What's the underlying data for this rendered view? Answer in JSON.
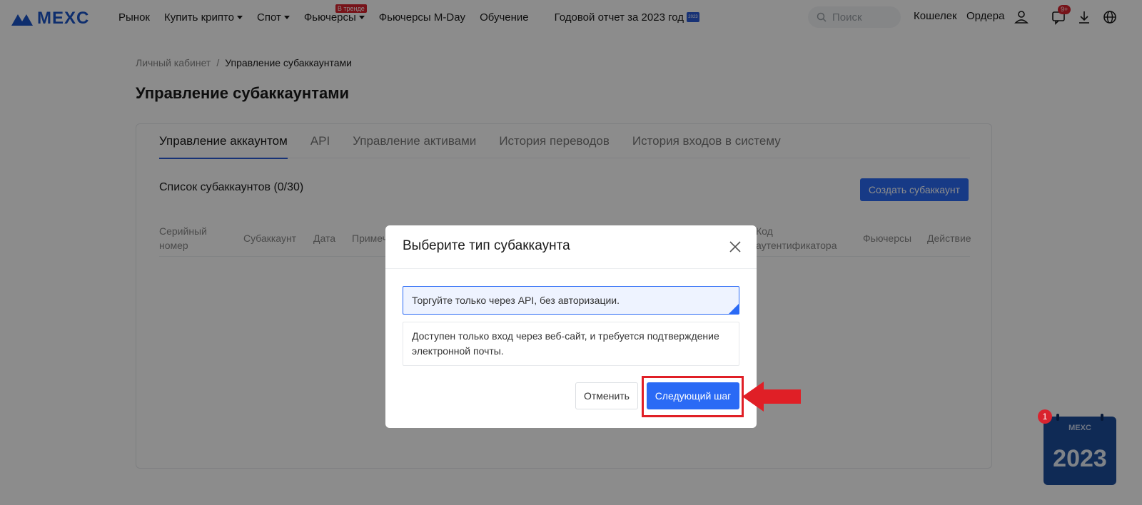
{
  "header": {
    "logo_text": "MEXC",
    "nav": [
      {
        "label": "Рынок",
        "caret": false
      },
      {
        "label": "Купить крипто",
        "caret": true
      },
      {
        "label": "Спот",
        "caret": true
      },
      {
        "label": "Фьючерсы",
        "caret": true
      },
      {
        "label": "Фьючерсы M-Day",
        "caret": false
      },
      {
        "label": "Обучение",
        "caret": false
      }
    ],
    "trend_badge": "В тренде",
    "report_link": "Годовой отчет за 2023 год",
    "report_flag_text": "2023",
    "search_placeholder": "Поиск",
    "wallet": "Кошелек",
    "orders": "Ордера",
    "notif_count": "9+"
  },
  "breadcrumb": {
    "root": "Личный кабинет",
    "separator": "/",
    "current": "Управление субаккаунтами"
  },
  "page_title": "Управление субаккаунтами",
  "tabs": [
    "Управление аккаунтом",
    "API",
    "Управление активами",
    "История переводов",
    "История входов в систему"
  ],
  "list_title": "Список субаккаунтов (0/30)",
  "create_button": "Создать субаккаунт",
  "columns": {
    "serial_line1": "Серийный",
    "serial_line2": "номер",
    "subaccount": "Субаккаунт",
    "date": "Дата",
    "note": "Примеч",
    "auth_line1": "Код",
    "auth_line2": "аутентификатора",
    "futures": "Фьючерсы",
    "action": "Действие"
  },
  "modal": {
    "title": "Выберите тип субаккаунта",
    "option_api": "Торгуйте только через API, без авторизации.",
    "option_web": "Доступен только вход через веб-сайт, и требуется подтверждение электронной почты.",
    "cancel": "Отменить",
    "next": "Следующий шаг"
  },
  "calendar": {
    "brand": "MEXC",
    "year": "2023",
    "badge": "1"
  },
  "colors": {
    "brand": "#1a55c8",
    "accent": "#2a6af5",
    "highlight": "#e01f26"
  }
}
